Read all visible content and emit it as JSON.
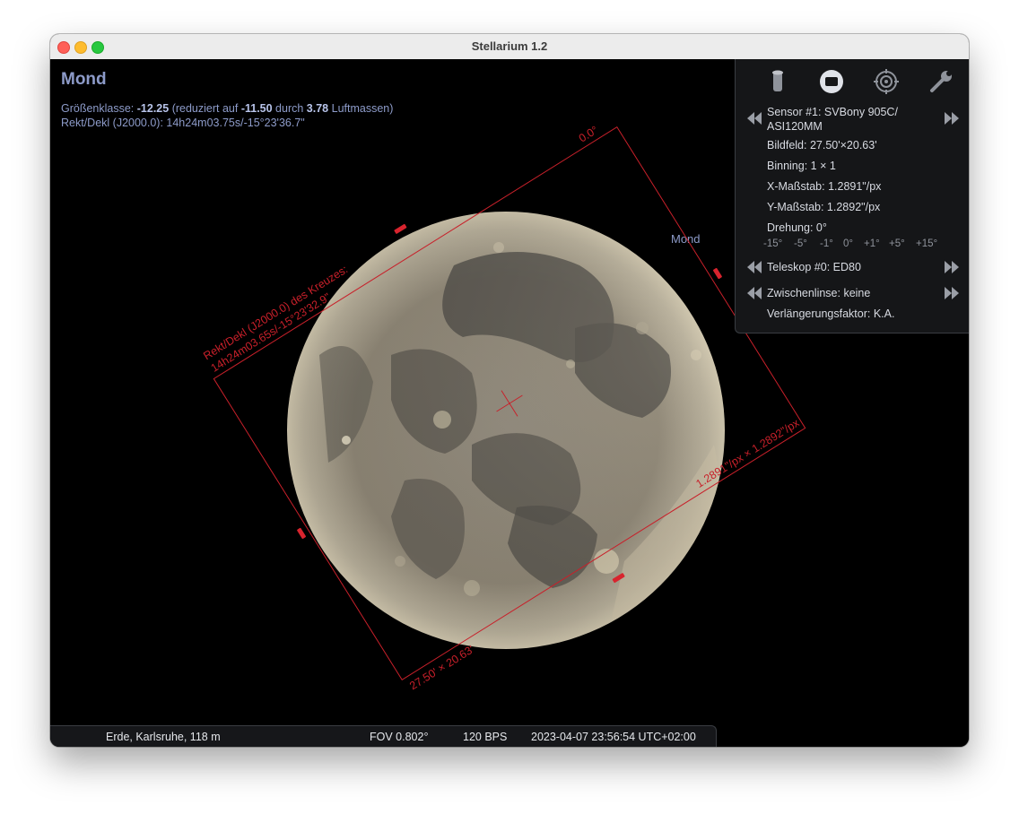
{
  "window": {
    "title": "Stellarium 1.2"
  },
  "object": {
    "name": "Mond",
    "mag_prefix": "Größenklasse: ",
    "mag_value": "-12.25",
    "mag_mid1": " (reduziert auf ",
    "mag_reduced": "-11.50",
    "mag_mid2": " durch ",
    "airmass": "3.78",
    "mag_suffix": " Luftmassen)",
    "radec": "Rekt/Dekl (J2000.0): 14h24m03.75s/-15°23'36.7\"",
    "sky_label": "Mond"
  },
  "ccd_frame": {
    "rotation_label": "0.0°",
    "center_label_line1": "Rekt/Dekl (J2000.0) des Kreuzes:",
    "center_label_line2": "14h24m03.65s/-15°23'32.9\"",
    "scale_label": "1.2891\"/px × 1.2892\"/px",
    "fov_label": "27.50' × 20.63'",
    "color": "#c8202a"
  },
  "panel": {
    "tabs": [
      "telescope-icon",
      "sensor-icon",
      "eyepiece-icon",
      "wrench-icon"
    ],
    "sensor": "Sensor #1: SVBony 905C/ ASI120MM",
    "sensor_line1": "Sensor #1: SVBony 905C/",
    "sensor_line2": "ASI120MM",
    "field": "Bildfeld: 27.50'×20.63'",
    "binning": "Binning: 1 × 1",
    "x_scale": "X-Maßstab: 1.2891\"/px",
    "y_scale": "Y-Maßstab: 1.2892\"/px",
    "rotation": "Drehung: 0°",
    "rotation_buttons": [
      "-15°",
      "-5°",
      "-1°",
      "0°",
      "+1°",
      "+5°",
      "+15°"
    ],
    "telescope": "Teleskop #0: ED80",
    "lens": "Zwischenlinse: keine",
    "extension": "Verlängerungsfaktor: K.A."
  },
  "status_bar": {
    "location": "Erde, Karlsruhe, 118 m",
    "fov": "FOV 0.802°",
    "fps": "120 BPS",
    "datetime": "2023-04-07 23:56:54 UTC+02:00"
  }
}
